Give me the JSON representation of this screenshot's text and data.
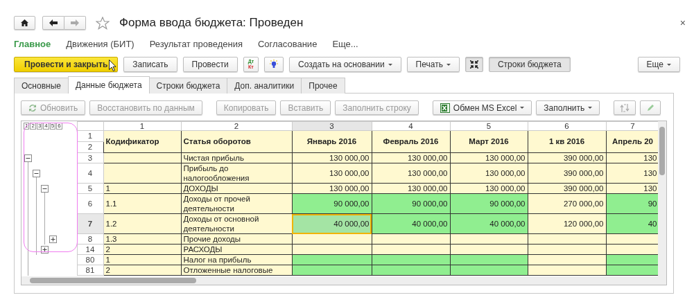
{
  "window": {
    "title": "Форма ввода бюджета: Проведен",
    "close": "×"
  },
  "nav": {
    "back_disabled": false,
    "forward_disabled": true
  },
  "menu": [
    {
      "label": "Главное",
      "selected": true
    },
    {
      "label": "Движения (БИТ)",
      "selected": false
    },
    {
      "label": "Результат проведения",
      "selected": false
    },
    {
      "label": "Согласование",
      "selected": false
    },
    {
      "label": "Еще...",
      "selected": false
    }
  ],
  "toolbar": [
    {
      "kind": "primary",
      "label": "Провести и закрыть"
    },
    {
      "kind": "button",
      "label": "Записать"
    },
    {
      "kind": "button",
      "label": "Провести"
    },
    {
      "kind": "dtkt",
      "top": "Дт",
      "bottom": "Кт"
    },
    {
      "kind": "bulb"
    },
    {
      "kind": "dropdown",
      "label": "Создать на основании"
    },
    {
      "kind": "dropdown",
      "label": "Печать"
    },
    {
      "kind": "collapse",
      "pressed": true
    },
    {
      "kind": "toggle",
      "label": "Строки бюджета",
      "pressed": true
    }
  ],
  "toolbar_more": "Еще",
  "tabs": [
    {
      "label": "Основные",
      "selected": false
    },
    {
      "label": "Данные бюджета",
      "selected": true
    },
    {
      "label": "Строки бюджета",
      "selected": false
    },
    {
      "label": "Доп. аналитики",
      "selected": false
    },
    {
      "label": "Прочее",
      "selected": false
    }
  ],
  "grid_toolbar": [
    {
      "kind": "refresh",
      "label": "Обновить",
      "disabled": true
    },
    {
      "kind": "button",
      "label": "Восстановить по данным",
      "disabled": true
    },
    {
      "kind": "button",
      "label": "Копировать",
      "disabled": true
    },
    {
      "kind": "button",
      "label": "Вставить",
      "disabled": true
    },
    {
      "kind": "button",
      "label": "Заполнить строку",
      "disabled": true
    },
    {
      "kind": "excel",
      "label": "Обмен MS Excel",
      "disabled": false
    },
    {
      "kind": "dropdown",
      "label": "Заполнить",
      "disabled": false
    },
    {
      "kind": "swap",
      "disabled": true
    },
    {
      "kind": "pencil",
      "disabled": true
    }
  ],
  "grid": {
    "outline_levels": [
      "1",
      "2",
      "3",
      "4",
      "5",
      "6"
    ],
    "column_numbers": [
      {
        "label": "1",
        "selected": false
      },
      {
        "label": "2",
        "selected": false
      },
      {
        "label": "3",
        "selected": true
      },
      {
        "label": "4",
        "selected": false
      },
      {
        "label": "5",
        "selected": false
      },
      {
        "label": "6",
        "selected": false
      },
      {
        "label": "7",
        "selected": false
      }
    ],
    "header_rows": [
      "1",
      "2"
    ],
    "headers": [
      "Кодификатор",
      "Статья оборотов",
      "Январь 2016",
      "Февраль 2016",
      "Март 2016",
      "1 кв 2016",
      "Апрель 20"
    ],
    "rows": [
      {
        "num": "3",
        "selected": false,
        "article": "Чистая прибыль",
        "expanded": true,
        "values": [
          {
            "text": "130 000,00",
            "editable": false,
            "selected": false
          },
          {
            "text": "130 000,00",
            "editable": false,
            "selected": false
          },
          {
            "text": "130 000,00",
            "editable": false,
            "selected": false
          },
          {
            "text": "390 000,00",
            "editable": false,
            "selected": false
          },
          {
            "text": "130",
            "editable": false,
            "selected": false
          }
        ],
        "children": [
          {
            "num": "4",
            "selected": false,
            "article": "Прибыль до налогообложения",
            "expanded": true,
            "values": [
              {
                "text": "130 000,00",
                "editable": false,
                "selected": false
              },
              {
                "text": "130 000,00",
                "editable": false,
                "selected": false
              },
              {
                "text": "130 000,00",
                "editable": false,
                "selected": false
              },
              {
                "text": "390 000,00",
                "editable": false,
                "selected": false
              },
              {
                "text": "130",
                "editable": false,
                "selected": false
              }
            ],
            "children": [
              {
                "num": "5",
                "code": "1",
                "selected": false,
                "article": "ДОХОДЫ",
                "expanded": true,
                "values": [
                  {
                    "text": "130 000,00",
                    "editable": false,
                    "selected": false
                  },
                  {
                    "text": "130 000,00",
                    "editable": false,
                    "selected": false
                  },
                  {
                    "text": "130 000,00",
                    "editable": false,
                    "selected": false
                  },
                  {
                    "text": "390 000,00",
                    "editable": false,
                    "selected": false
                  },
                  {
                    "text": "130",
                    "editable": false,
                    "selected": false
                  }
                ],
                "children": [
                  {
                    "num": "6",
                    "code": "1.1",
                    "selected": false,
                    "article": "Доходы от прочей деятельности",
                    "values": [
                      {
                        "text": "90 000,00",
                        "editable": true,
                        "selected": false
                      },
                      {
                        "text": "90 000,00",
                        "editable": true,
                        "selected": false
                      },
                      {
                        "text": "90 000,00",
                        "editable": true,
                        "selected": false
                      },
                      {
                        "text": "270 000,00",
                        "editable": false,
                        "selected": false
                      },
                      {
                        "text": "90",
                        "editable": true,
                        "selected": false
                      }
                    ]
                  },
                  {
                    "num": "7",
                    "code": "1.2",
                    "selected": true,
                    "article": "Доходы от основной деятельности",
                    "values": [
                      {
                        "text": "40 000,00",
                        "editable": true,
                        "selected": true
                      },
                      {
                        "text": "40 000,00",
                        "editable": true,
                        "selected": false
                      },
                      {
                        "text": "40 000,00",
                        "editable": true,
                        "selected": false
                      },
                      {
                        "text": "120 000,00",
                        "editable": false,
                        "selected": false
                      },
                      {
                        "text": "40",
                        "editable": true,
                        "selected": false
                      }
                    ]
                  },
                  {
                    "num": "8",
                    "code": "1.3",
                    "selected": false,
                    "article": "Прочие доходы",
                    "expanded": false,
                    "values": [
                      {
                        "editable": false,
                        "selected": false
                      },
                      {
                        "editable": false,
                        "selected": false
                      },
                      {
                        "editable": false,
                        "selected": false
                      },
                      {
                        "editable": false,
                        "selected": false
                      },
                      {
                        "editable": false,
                        "selected": false
                      }
                    ]
                  }
                ]
              },
              {
                "num": "14",
                "code": "2",
                "selected": false,
                "article": "РАСХОДЫ",
                "expanded": false,
                "values": [
                  {
                    "editable": false,
                    "selected": false
                  },
                  {
                    "editable": false,
                    "selected": false
                  },
                  {
                    "editable": false,
                    "selected": false
                  },
                  {
                    "editable": false,
                    "selected": false
                  },
                  {
                    "editable": false,
                    "selected": false
                  }
                ]
              }
            ]
          },
          {
            "num": "80",
            "code": "1",
            "selected": false,
            "article": "Налог на прибыль",
            "values": [
              {
                "editable": true,
                "selected": false
              },
              {
                "editable": true,
                "selected": false
              },
              {
                "editable": true,
                "selected": false
              },
              {
                "editable": false,
                "selected": false
              },
              {
                "editable": true,
                "selected": false
              }
            ]
          },
          {
            "num": "81",
            "code": "2",
            "selected": false,
            "article": "Отложенные налоговые",
            "values": [
              {
                "editable": true,
                "selected": false
              },
              {
                "editable": true,
                "selected": false
              },
              {
                "editable": true,
                "selected": false
              },
              {
                "editable": false,
                "selected": false
              },
              {
                "editable": true,
                "selected": false
              }
            ]
          }
        ]
      }
    ]
  }
}
